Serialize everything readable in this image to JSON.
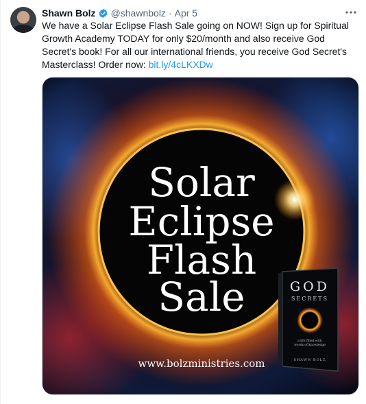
{
  "tweet": {
    "author_name": "Shawn Bolz",
    "handle": "@shawnbolz",
    "separator": "·",
    "date": "Apr 5",
    "more_icon": "more-horizontal-icon",
    "text": "We have a Solar Eclipse Flash Sale going on NOW! Sign up for Spiritual Growth Academy TODAY for only $20/month and also receive God Secret's book! For all our international friends, you receive God Secret's Masterclass!  Order now: ",
    "link_text": "bit.ly/4cLKXDw"
  },
  "media": {
    "headline_lines": [
      "Solar",
      "Eclipse",
      "Flash",
      "Sale"
    ],
    "website": "www.bolzministries.com",
    "book": {
      "title_top": "GOD",
      "title_bottom": "SECRETS",
      "tagline_line1": "a life filled with",
      "tagline_line2": "words of knowledge",
      "author": "SHAWN BOLZ"
    }
  },
  "colors": {
    "link": "#1d9bf0",
    "verified": "#1d9bf0",
    "muted_text": "#536471"
  }
}
